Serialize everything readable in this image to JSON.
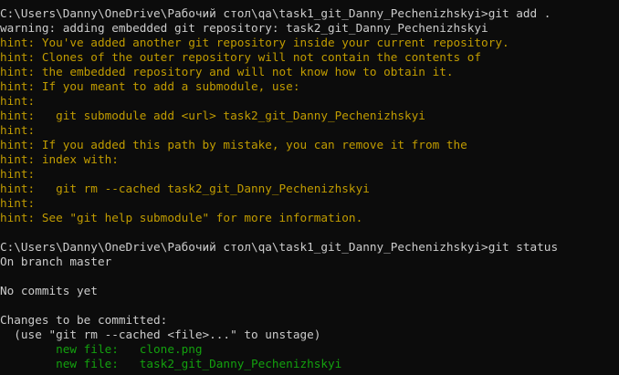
{
  "terminal": {
    "lines": [
      {
        "text": "C:\\Users\\Danny\\OneDrive\\Рабочий стол\\qa\\task1_git_Danny_Pechenizhskyi>git add .",
        "style": "prompt"
      },
      {
        "text": "warning: adding embedded git repository: task2_git_Danny_Pechenizhskyi",
        "style": "plain"
      },
      {
        "text": "hint: You've added another git repository inside your current repository.",
        "style": "hint"
      },
      {
        "text": "hint: Clones of the outer repository will not contain the contents of",
        "style": "hint"
      },
      {
        "text": "hint: the embedded repository and will not know how to obtain it.",
        "style": "hint"
      },
      {
        "text": "hint: If you meant to add a submodule, use:",
        "style": "hint"
      },
      {
        "text": "hint:",
        "style": "hint"
      },
      {
        "text": "hint:   git submodule add <url> task2_git_Danny_Pechenizhskyi",
        "style": "hint"
      },
      {
        "text": "hint:",
        "style": "hint"
      },
      {
        "text": "hint: If you added this path by mistake, you can remove it from the",
        "style": "hint"
      },
      {
        "text": "hint: index with:",
        "style": "hint"
      },
      {
        "text": "hint:",
        "style": "hint"
      },
      {
        "text": "hint:   git rm --cached task2_git_Danny_Pechenizhskyi",
        "style": "hint"
      },
      {
        "text": "hint:",
        "style": "hint"
      },
      {
        "text": "hint: See \"git help submodule\" for more information.",
        "style": "hint"
      },
      {
        "text": "",
        "style": "plain"
      },
      {
        "text": "C:\\Users\\Danny\\OneDrive\\Рабочий стол\\qa\\task1_git_Danny_Pechenizhskyi>git status",
        "style": "prompt"
      },
      {
        "text": "On branch master",
        "style": "plain"
      },
      {
        "text": "",
        "style": "plain"
      },
      {
        "text": "No commits yet",
        "style": "plain"
      },
      {
        "text": "",
        "style": "plain"
      },
      {
        "text": "Changes to be committed:",
        "style": "plain"
      },
      {
        "text": "  (use \"git rm --cached <file>...\" to unstage)",
        "style": "plain"
      },
      {
        "text": "        new file:   clone.png",
        "style": "staged-label"
      },
      {
        "text": "        new file:   task2_git_Danny_Pechenizhskyi",
        "style": "staged-label"
      }
    ]
  },
  "colors": {
    "background": "#0c0c0c",
    "foreground": "#cccccc",
    "hint": "#c19c00",
    "staged": "#13a10e"
  }
}
